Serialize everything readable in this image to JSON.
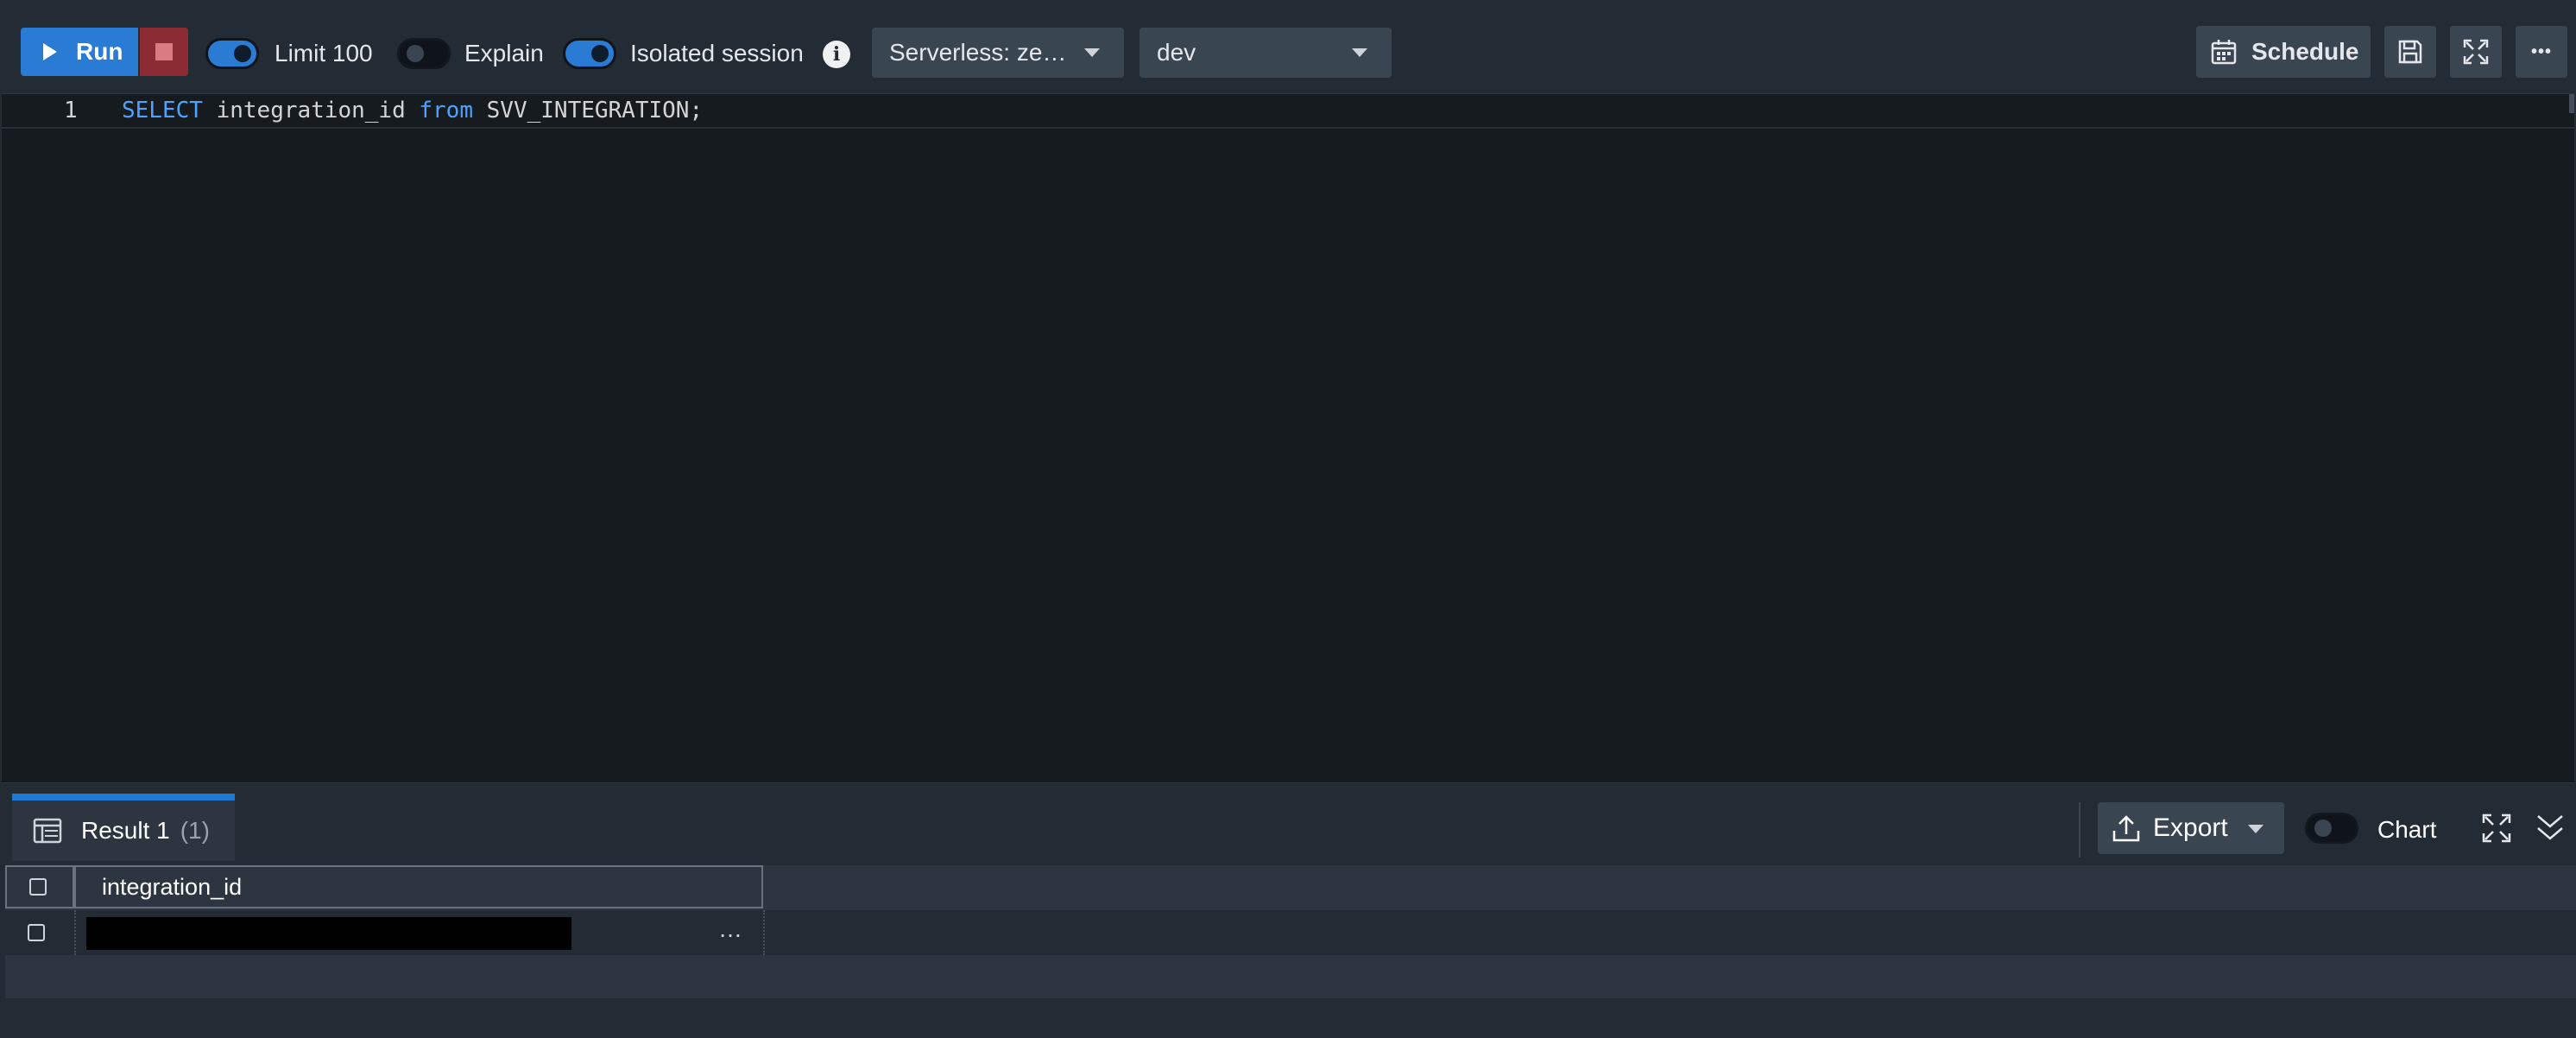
{
  "toolbar": {
    "run_label": "Run",
    "limit_label": "Limit 100",
    "limit_enabled": true,
    "explain_label": "Explain",
    "explain_enabled": false,
    "isolated_label": "Isolated session",
    "isolated_enabled": true,
    "info_glyph": "i",
    "workgroup_value": "Serverless: ze…",
    "database_value": "dev",
    "schedule_label": "Schedule",
    "more_glyph": "•••"
  },
  "editor": {
    "lines": [
      {
        "number": "1",
        "keyword1": "SELECT",
        "text1": " integration_id ",
        "keyword2": "from",
        "text2": " SVV_INTEGRATION;"
      }
    ]
  },
  "results": {
    "tab_label": "Result 1",
    "tab_count": "(1)",
    "export_label": "Export",
    "chart_label": "Chart",
    "chart_enabled": false,
    "columns": [
      "integration_id"
    ],
    "rows": [
      {
        "integration_id": "",
        "truncated_glyph": "…",
        "redacted": true
      }
    ]
  },
  "colors": {
    "run_button": "#2a7bd4",
    "stop_button": "#8b2c35",
    "editor_bg": "#161b1f",
    "keyword": "#4da3ff",
    "active_tab": "#1f7ad3"
  }
}
